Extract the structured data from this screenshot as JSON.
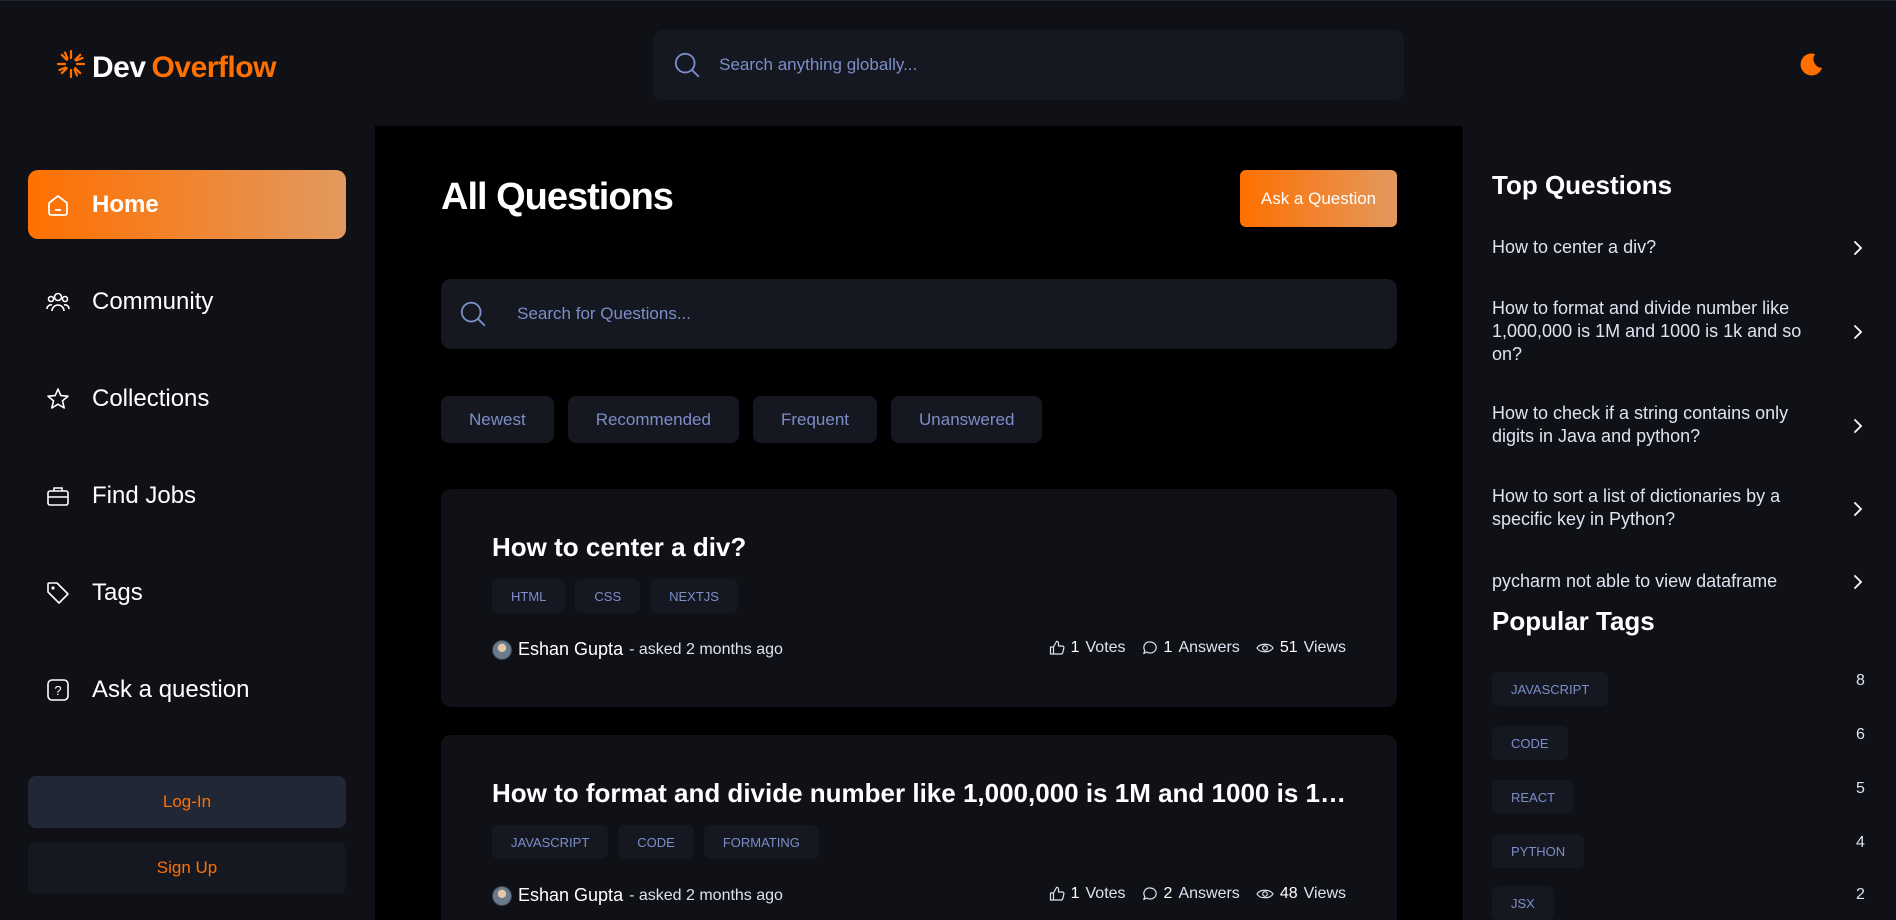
{
  "brand": {
    "word1": "Dev",
    "word2": "Overflow"
  },
  "global_search": {
    "placeholder": "Search anything globally..."
  },
  "sidebar": {
    "items": [
      {
        "label": "Home",
        "icon": "home-icon",
        "active": true
      },
      {
        "label": "Community",
        "icon": "users-icon"
      },
      {
        "label": "Collections",
        "icon": "star-icon"
      },
      {
        "label": "Find Jobs",
        "icon": "suitcase-icon"
      },
      {
        "label": "Tags",
        "icon": "tag-icon"
      },
      {
        "label": "Ask a question",
        "icon": "question-icon"
      }
    ],
    "login_label": "Log-In",
    "signup_label": "Sign Up"
  },
  "main": {
    "title": "All Questions",
    "ask_button": "Ask a Question",
    "search_placeholder": "Search for Questions...",
    "filters": [
      "Newest",
      "Recommended",
      "Frequent",
      "Unanswered"
    ],
    "questions": [
      {
        "title": "How to center a div?",
        "tags": [
          "HTML",
          "CSS",
          "NEXTJS"
        ],
        "author": "Eshan Gupta",
        "asked": "- asked 2 months ago",
        "votes": "1",
        "votes_label": "Votes",
        "answers": "1",
        "answers_label": "Answers",
        "views": "51",
        "views_label": "Views"
      },
      {
        "title": "How to format and divide number like 1,000,000 is 1M and 1000 is 1k...",
        "tags": [
          "JAVASCRIPT",
          "CODE",
          "FORMATING"
        ],
        "author": "Eshan Gupta",
        "asked": "- asked 2 months ago",
        "votes": "1",
        "votes_label": "Votes",
        "answers": "2",
        "answers_label": "Answers",
        "views": "48",
        "views_label": "Views"
      }
    ]
  },
  "rightbar": {
    "top_questions_title": "Top Questions",
    "top_questions": [
      "How to center a div?",
      "How to format and divide number like 1,000,000 is 1M and 1000 is 1k and so on?",
      "How to check if a string contains only digits in Java and python?",
      "How to sort a list of dictionaries by a specific key in Python?",
      "pycharm not able to view dataframe"
    ],
    "popular_tags_title": "Popular Tags",
    "popular_tags": [
      {
        "name": "JAVASCRIPT",
        "count": "8"
      },
      {
        "name": "CODE",
        "count": "6"
      },
      {
        "name": "REACT",
        "count": "5"
      },
      {
        "name": "PYTHON",
        "count": "4"
      },
      {
        "name": "JSX",
        "count": "2"
      }
    ]
  },
  "colors": {
    "accent": "#ff7000",
    "accent_light": "#e2995f",
    "muted_text": "#7b8ec8",
    "surface": "#0f1117",
    "input_bg": "#151821"
  }
}
